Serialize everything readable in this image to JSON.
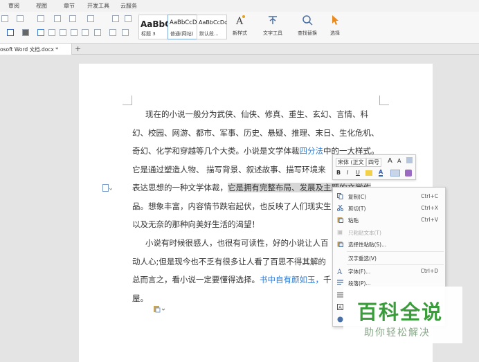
{
  "menubar": {
    "items": [
      "审阅",
      "视图",
      "章节",
      "开发工具",
      "云服务"
    ]
  },
  "ribbon": {
    "styles": [
      {
        "preview": "AaBbC",
        "caption": "标题 3"
      },
      {
        "preview": "AaBbCcD",
        "caption": "普通(网站)"
      },
      {
        "preview": "AaBbCcDc",
        "caption": "默认段..."
      }
    ],
    "new_style": "新样式",
    "text_tools": "文字工具",
    "find_replace": "查找替换",
    "select": "选择"
  },
  "tabs": {
    "doc_title": "osoft Word 文档.docx *",
    "add": "+"
  },
  "document": {
    "p1": {
      "lines": [
        "现在的小说一般分为武侠、仙侠、修真、重生、玄幻、言情、科",
        "幻、校园、网游、都市、军事、历史、悬疑、推理、末日、生化危机、",
        "奇幻、化学和穿越等几个大类。小说是文学体裁",
        "四分法",
        "中的一大样式。",
        "它是通过塑造人物、 描写背景、叙述故事、描写环境来",
        "表达思想的一种文学体裁，",
        "它是拥有完整布局、发展及主题的文学作",
        "品。想象丰富，内容情节跌宕起伏，也反映了人们现实生",
        "以及无奈的那种向美好生活的渴望！"
      ]
    },
    "p2": {
      "lines": [
        "小说有时候很感人，也很有可读性，好的小说让人百",
        "动人心;但是现今也不乏有很多让人看了百思不得其解的",
        "总而言之，看小说一定要懂得选择。",
        "书中自有颜如玉，",
        "千",
        "屋。"
      ]
    }
  },
  "mini_toolbar": {
    "font": "宋体 (正文",
    "size": "四号",
    "grow": "A",
    "shrink": "A",
    "bold": "B",
    "italic": "I",
    "underline": "U",
    "color_a": "A"
  },
  "context_menu": {
    "items": [
      {
        "label": "复制(C)",
        "shortcut": "Ctrl+C",
        "enabled": true
      },
      {
        "label": "剪切(T)",
        "shortcut": "Ctrl+X",
        "enabled": true
      },
      {
        "label": "粘贴",
        "shortcut": "Ctrl+V",
        "enabled": true
      },
      {
        "label": "只粘贴文本(T)",
        "shortcut": "",
        "enabled": false
      },
      {
        "label": "选择性粘贴(S)...",
        "shortcut": "",
        "enabled": true
      },
      {
        "label": "汉字重选(V)",
        "shortcut": "",
        "enabled": true
      },
      {
        "label": "字体(F)...",
        "shortcut": "Ctrl+D",
        "enabled": true
      },
      {
        "label": "段落(P)...",
        "shortcut": "",
        "enabled": true
      }
    ]
  },
  "watermark": {
    "title": "百科全说",
    "subtitle": "助你轻松解决"
  },
  "colors": {
    "accent_blue": "#2f7bd4",
    "watermark_green": "#3b9c3b",
    "selection_gray": "#d7d7d7"
  }
}
